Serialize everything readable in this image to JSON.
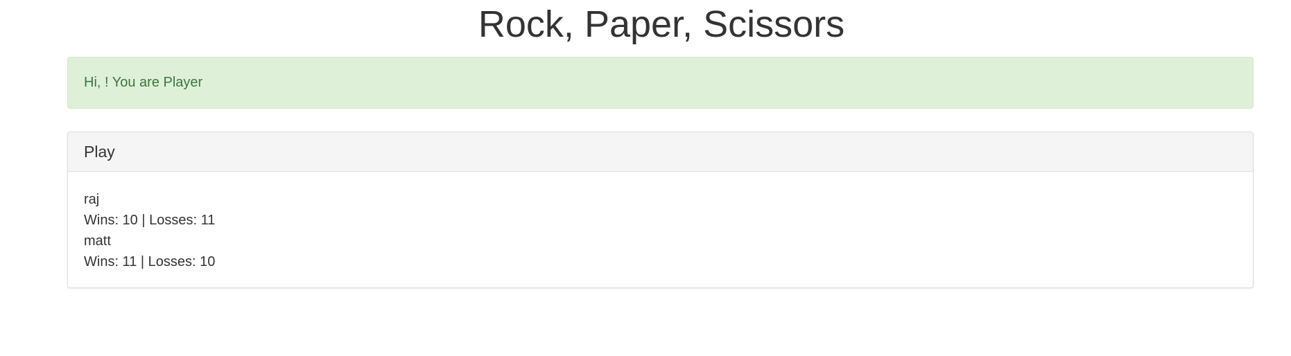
{
  "header": {
    "title": "Rock, Paper, Scissors"
  },
  "alert": {
    "text": "Hi, ! You are Player",
    "color": "#3c763d",
    "background": "#dff0d8"
  },
  "panel": {
    "title": "Play",
    "players": [
      {
        "name": "raj",
        "stats": "Wins: 10 | Losses: 11"
      },
      {
        "name": "matt",
        "stats": "Wins: 11 | Losses: 10"
      }
    ]
  }
}
